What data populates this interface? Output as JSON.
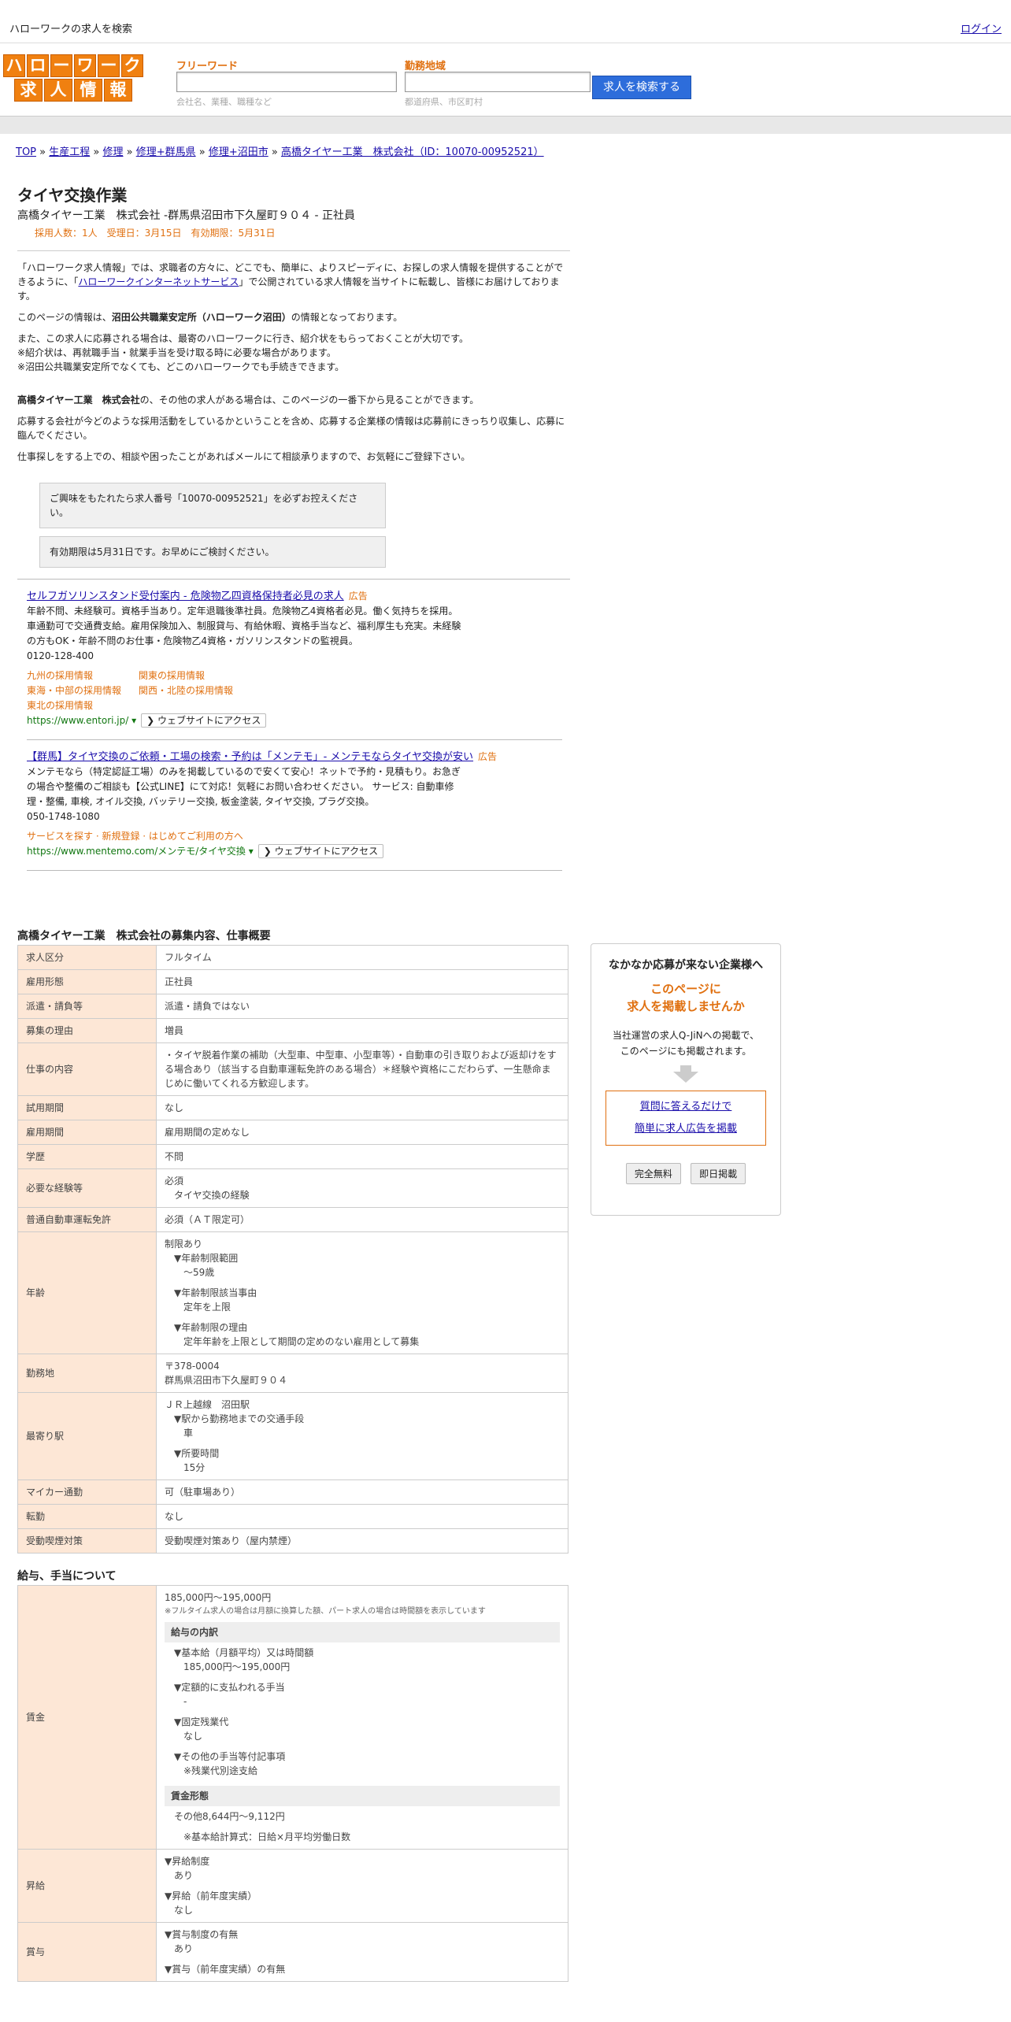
{
  "topbar": {
    "title": "ハローワークの求人を検索",
    "login": "ログイン"
  },
  "logo": {
    "row1": [
      "ハ",
      "ロ",
      "ー",
      "ワ",
      "ー",
      "ク"
    ],
    "row2": [
      "求",
      "人",
      "情",
      "報"
    ]
  },
  "search": {
    "keyword_label": "フリーワード",
    "keyword_placeholder": "会社名、業種、職種など",
    "area_label": "勤務地域",
    "area_placeholder": "都道府県、市区町村",
    "button": "求人を検索する"
  },
  "breadcrumb": [
    "TOP",
    "生産工程",
    "修理",
    "修理+群馬県",
    "修理+沼田市",
    "高橋タイヤー工業　株式会社（ID：10070-00952521）"
  ],
  "breadcrumb_sep": "»",
  "job": {
    "title": "タイヤ交換作業",
    "company_line": "高橋タイヤー工業　株式会社 -群馬県沼田市下久屋町９０４ - 正社員",
    "meta": "採用人数：1人　受理日：3月15日　有効期限：5月31日"
  },
  "intro": {
    "p1a": "「ハローワーク求人情報」では、求職者の方々に、どこでも、簡単に、よりスピーディに、お探しの求人情報を提供することができるように、「",
    "p1link": "ハローワークインターネットサービス",
    "p1b": "」で公開されている求人情報を当サイトに転載し、皆様にお届けしております。",
    "p2a": "このページの情報は、",
    "p2b": "沼田公共職業安定所（ハローワーク沼田）",
    "p2c": "の情報となっております。",
    "p3": [
      "また、この求人に応募される場合は、最寄のハローワークに行き、紹介状をもらっておくことが大切です。",
      "※紹介状は、再就職手当・就業手当を受け取る時に必要な場合があります。",
      "※沼田公共職業安定所でなくても、どこのハローワークでも手続きできます。"
    ],
    "p4a": "高橋タイヤー工業　株式会社",
    "p4b": "の、その他の求人がある場合は、このページの一番下から見ることができます。",
    "p5": "応募する会社が今どのような採用活動をしているかということを含め、応募する企業様の情報は応募前にきっちり収集し、応募に臨んでください。",
    "p6": "仕事探しをする上での、相談や困ったことがあればメールにて相談承りますので、お気軽にご登録下さい。",
    "box1": "ご興味をもたれたら求人番号「10070-00952521」を必ずお控えください。",
    "box2": "有効期限は5月31日です。お早めにご検討ください。"
  },
  "ads": [
    {
      "title": "セルフガソリンスタンド受付案内 - 危険物乙四資格保持者必見の求人",
      "tag": "広告",
      "lines": [
        "年齢不問、未経験可。資格手当あり。定年退職後準社員。危険物乙4資格者必見。働く気持ちを採用。",
        "車通勤可で交通費支給。雇用保険加入、制服貸与、有給休暇、資格手当など、福利厚生も充実。未経験",
        "の方もOK・年齢不問のお仕事・危険物乙4資格・ガソリンスタンドの監視員。"
      ],
      "phone": "0120-128-400",
      "sublinks": [
        [
          "九州の採用情報",
          "関東の採用情報"
        ],
        [
          "東海・中部の採用情報",
          "関西・北陸の採用情報"
        ],
        [
          "東北の採用情報"
        ]
      ],
      "url": "https://www.entori.jp/",
      "visit": "❯ ウェブサイトにアクセス"
    },
    {
      "title": "【群馬】タイヤ交換のご依頼・工場の検索・予約は「メンテモ」- メンテモならタイヤ交換が安い",
      "tag": "広告",
      "lines": [
        "メンテモなら（特定認証工場）のみを掲載しているので安くて安心！ネットで予約・見積もり。お急ぎ",
        "の場合や整備のご相談も【公式LINE】にて対応！気軽にお問い合わせください。 サービス: 自動車修",
        "理・整備, 車検, オイル交換, バッテリー交換, 板金塗装, タイヤ交換, プラグ交換。"
      ],
      "phone": "050-1748-1080",
      "sublink_single": "サービスを探す · 新規登録 · はじめてご利用の方へ",
      "url": "https://www.mentemo.com/メンテモ/タイヤ交換",
      "visit": "❯ ウェブサイトにアクセス"
    }
  ],
  "overview": {
    "title": "高橋タイヤー工業　株式会社の募集内容、仕事概要",
    "rows": [
      {
        "k": "求人区分",
        "v": [
          "フルタイム"
        ]
      },
      {
        "k": "雇用形態",
        "v": [
          "正社員"
        ]
      },
      {
        "k": "派遣・請負等",
        "v": [
          "派遣・請負ではない"
        ]
      },
      {
        "k": "募集の理由",
        "v": [
          "増員"
        ]
      },
      {
        "k": "仕事の内容",
        "v": [
          "・タイヤ脱着作業の補助（大型車、中型車、小型車等）・自動車の引き取りおよび返却けをする場合あり（該当する自動車運転免許のある場合）＊経験や資格にこだわらず、一生懸命まじめに働いてくれる方歓迎します。"
        ]
      },
      {
        "k": "試用期間",
        "v": [
          "なし"
        ]
      },
      {
        "k": "雇用期間",
        "v": [
          "雇用期間の定めなし"
        ]
      },
      {
        "k": "学歴",
        "v": [
          "不問"
        ]
      },
      {
        "k": "必要な経験等",
        "v": [
          "必須",
          "　タイヤ交換の経験"
        ]
      },
      {
        "k": "普通自動車運転免許",
        "v": [
          "必須（ＡＴ限定可）"
        ]
      },
      {
        "k": "年齢",
        "v": [
          "制限あり",
          "　▼年齢制限範囲",
          "　　〜59歳",
          "",
          "　▼年齢制限該当事由",
          "　　定年を上限",
          "",
          "　▼年齢制限の理由",
          "　　定年年齢を上限として期間の定めのない雇用として募集"
        ]
      },
      {
        "k": "勤務地",
        "v": [
          "〒378-0004",
          "群馬県沼田市下久屋町９０４"
        ]
      },
      {
        "k": "最寄り駅",
        "v": [
          "ＪＲ上越線　沼田駅",
          "　▼駅から勤務地までの交通手段",
          "　　車",
          "",
          "　▼所要時間",
          "　　15分"
        ]
      },
      {
        "k": "マイカー通勤",
        "v": [
          "可（駐車場あり）"
        ]
      },
      {
        "k": "転勤",
        "v": [
          "なし"
        ]
      },
      {
        "k": "受動喫煙対策",
        "v": [
          "受動喫煙対策あり（屋内禁煙）"
        ]
      }
    ]
  },
  "salary": {
    "title": "給与、手当について",
    "wage_key": "賃金",
    "wage_main": "185,000円〜195,000円",
    "wage_note": "※フルタイム求人の場合は月額に換算した額、パート求人の場合は時間額を表示しています",
    "breakdown_head": "給与の内訳",
    "breakdown": [
      "▼基本給（月額平均）又は時間額",
      "　185,000円〜195,000円",
      "",
      "▼定額的に支払われる手当",
      "　-",
      "",
      "▼固定残業代",
      "　なし",
      "",
      "▼その他の手当等付記事項",
      "　※残業代別途支給"
    ],
    "form_head": "賃金形態",
    "form_lines": [
      "その他8,644円〜9,112円",
      "",
      "　※基本給計算式：日給×月平均労働日数"
    ],
    "raise_key": "昇給",
    "raise": [
      "▼昇給制度",
      "　あり",
      "",
      "▼昇給（前年度実績）",
      "　なし"
    ],
    "bonus_key": "賞与",
    "bonus": [
      "▼賞与制度の有無",
      "　あり",
      "",
      "▼賞与（前年度実績）の有無"
    ]
  },
  "side": {
    "heading": "なかなか応募が来ない企業様へ",
    "hl1": "このページに",
    "hl2": "求人を掲載しませんか",
    "desc1": "当社運営の求人Q-JiNへの掲載で、",
    "desc2": "このページにも掲載されます。",
    "link1": "質問に答えるだけで",
    "link2": "簡単に求人広告を掲載",
    "btn1": "完全無料",
    "btn2": "即日掲載"
  }
}
